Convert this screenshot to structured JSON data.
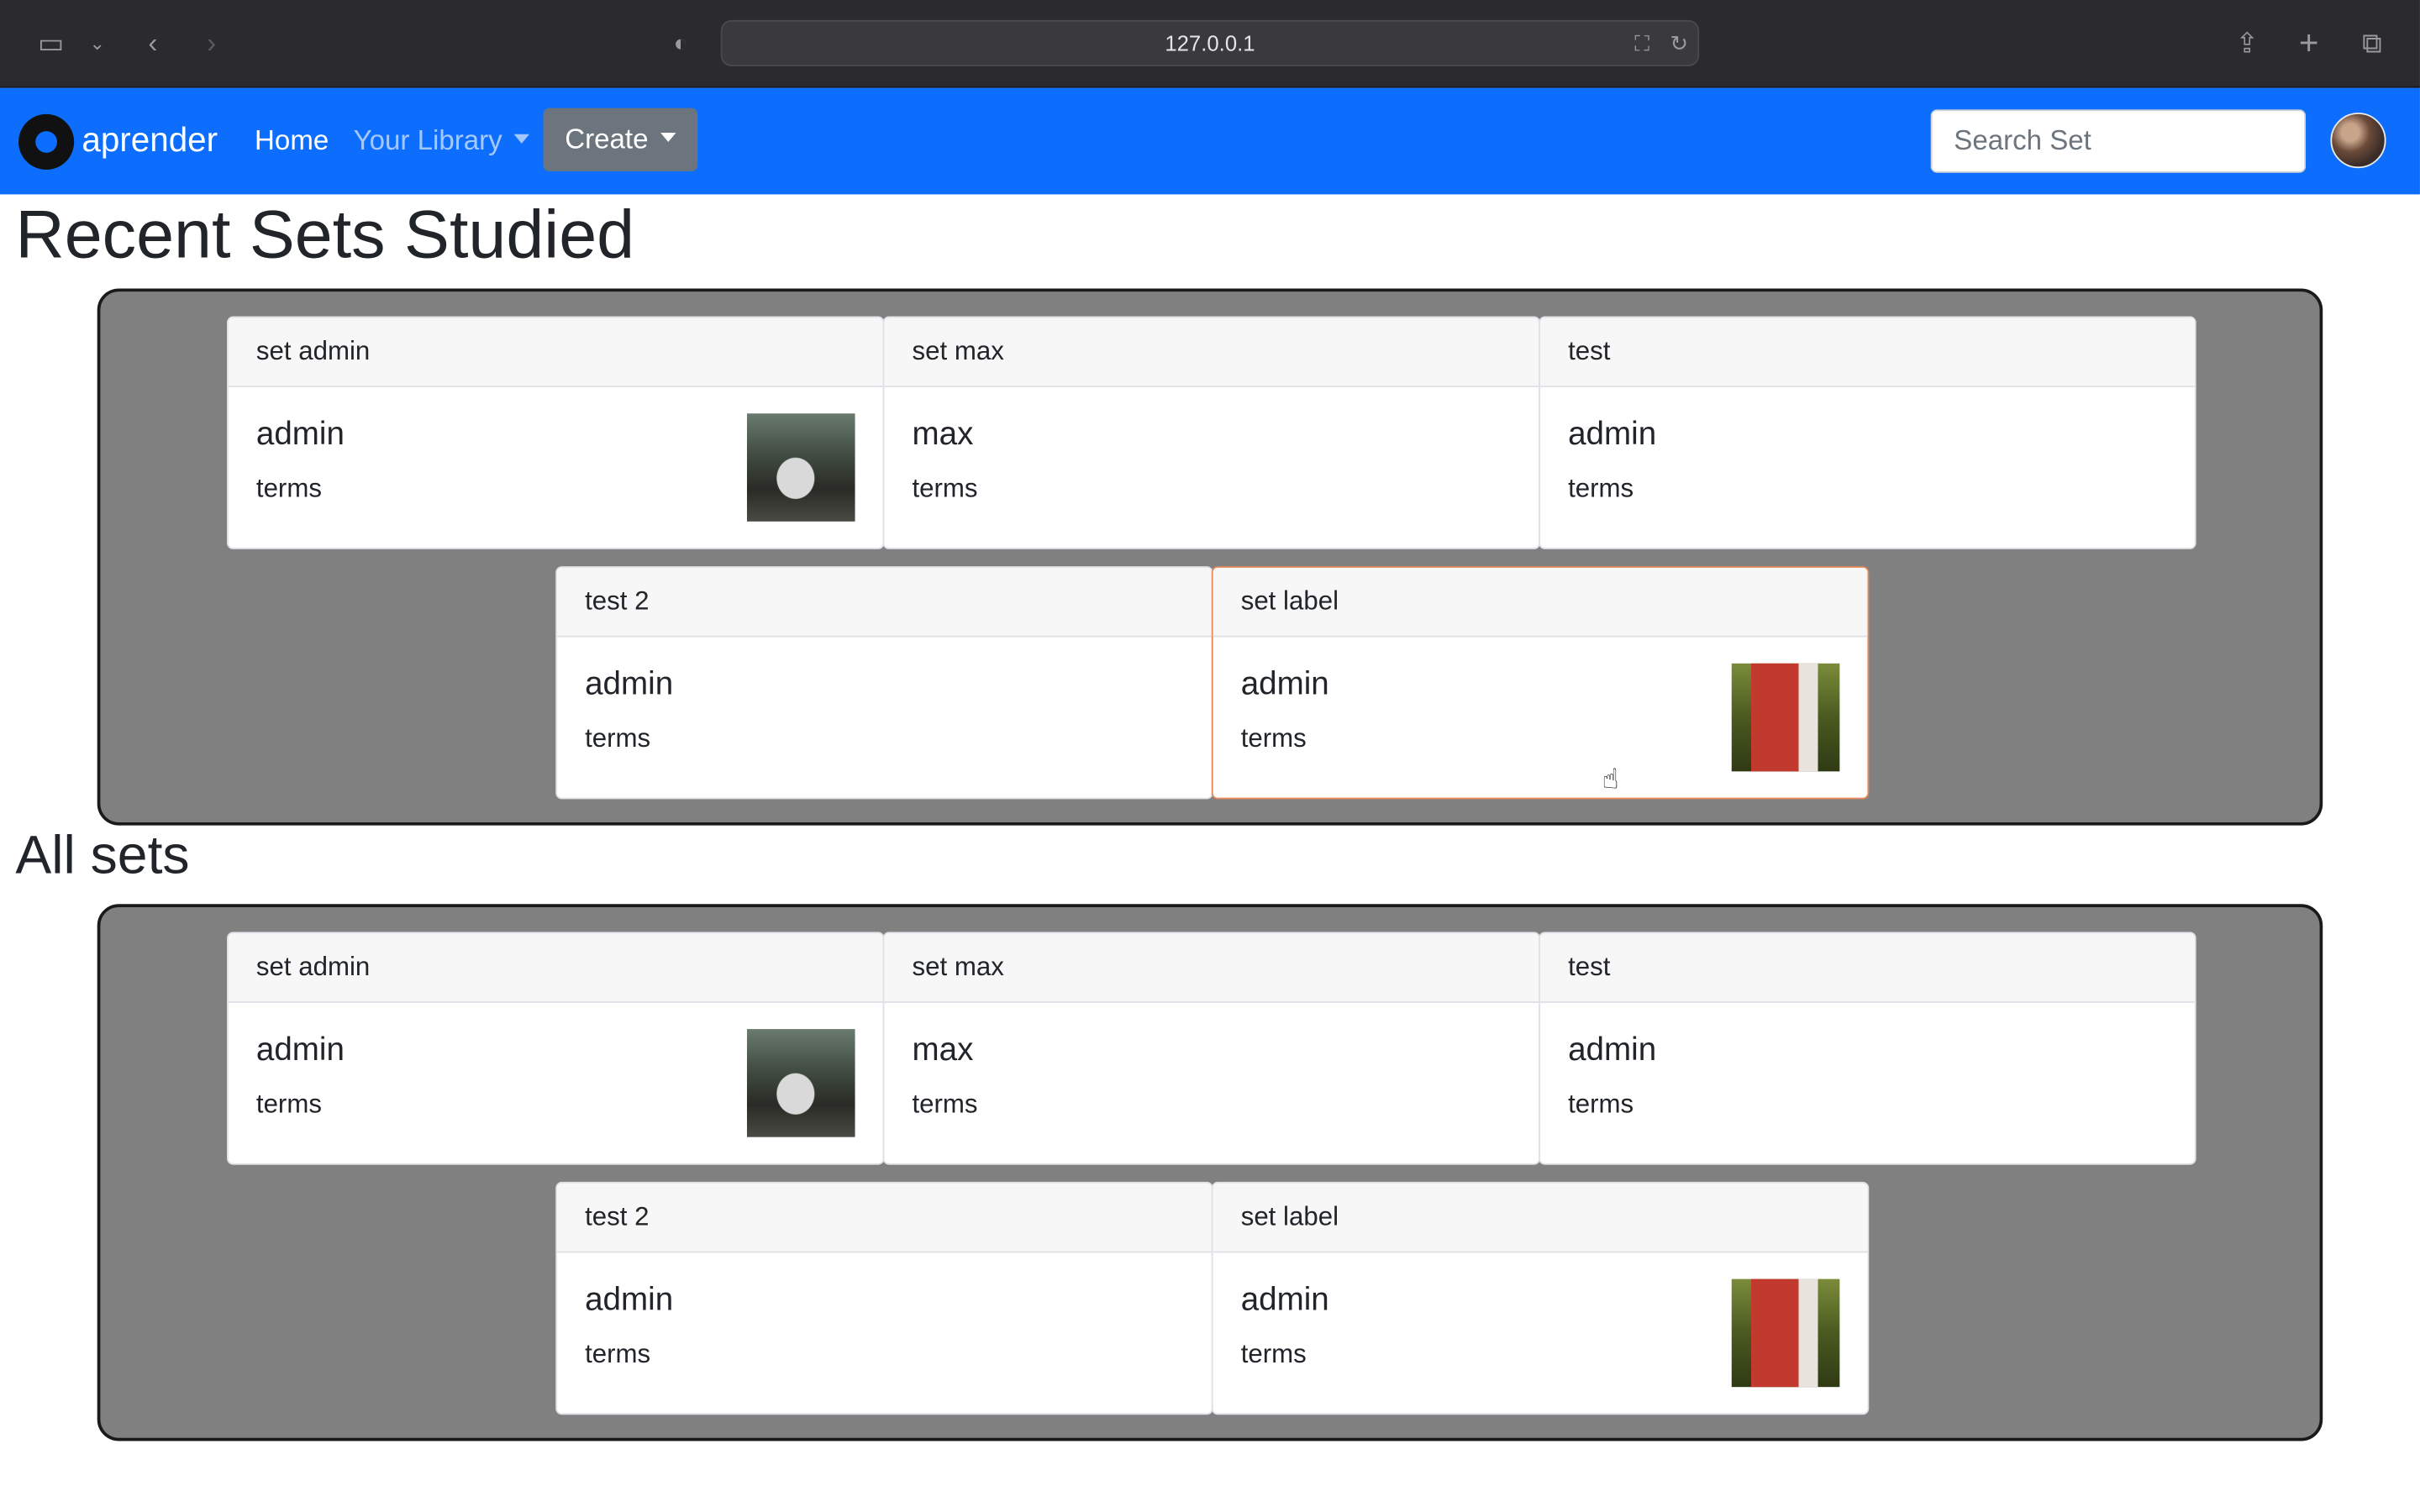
{
  "browser": {
    "url": "127.0.0.1"
  },
  "navbar": {
    "brand": "aprender",
    "home": "Home",
    "library": "Your Library",
    "create": "Create",
    "search_placeholder": "Search Set"
  },
  "recent": {
    "heading": "Recent Sets Studied",
    "cards": [
      {
        "title": "set admin",
        "owner": "admin",
        "terms": "terms",
        "image": "car-photo"
      },
      {
        "title": "set max",
        "owner": "max",
        "terms": "terms",
        "image": null
      },
      {
        "title": "test",
        "owner": "admin",
        "terms": "terms",
        "image": null
      },
      {
        "title": "test 2",
        "owner": "admin",
        "terms": "terms",
        "image": null
      },
      {
        "title": "set label",
        "owner": "admin",
        "terms": "terms",
        "image": "book-photo"
      }
    ]
  },
  "all": {
    "heading": "All sets",
    "cards": [
      {
        "title": "set admin",
        "owner": "admin",
        "terms": "terms",
        "image": "car-photo"
      },
      {
        "title": "set max",
        "owner": "max",
        "terms": "terms",
        "image": null
      },
      {
        "title": "test",
        "owner": "admin",
        "terms": "terms",
        "image": null
      },
      {
        "title": "test 2",
        "owner": "admin",
        "terms": "terms",
        "image": null
      },
      {
        "title": "set label",
        "owner": "admin",
        "terms": "terms",
        "image": "book-photo"
      }
    ]
  },
  "colors": {
    "navbar": "#0d6efd",
    "panel": "#808080",
    "create_button": "#6c757d",
    "highlight_border": "#e8885a"
  }
}
